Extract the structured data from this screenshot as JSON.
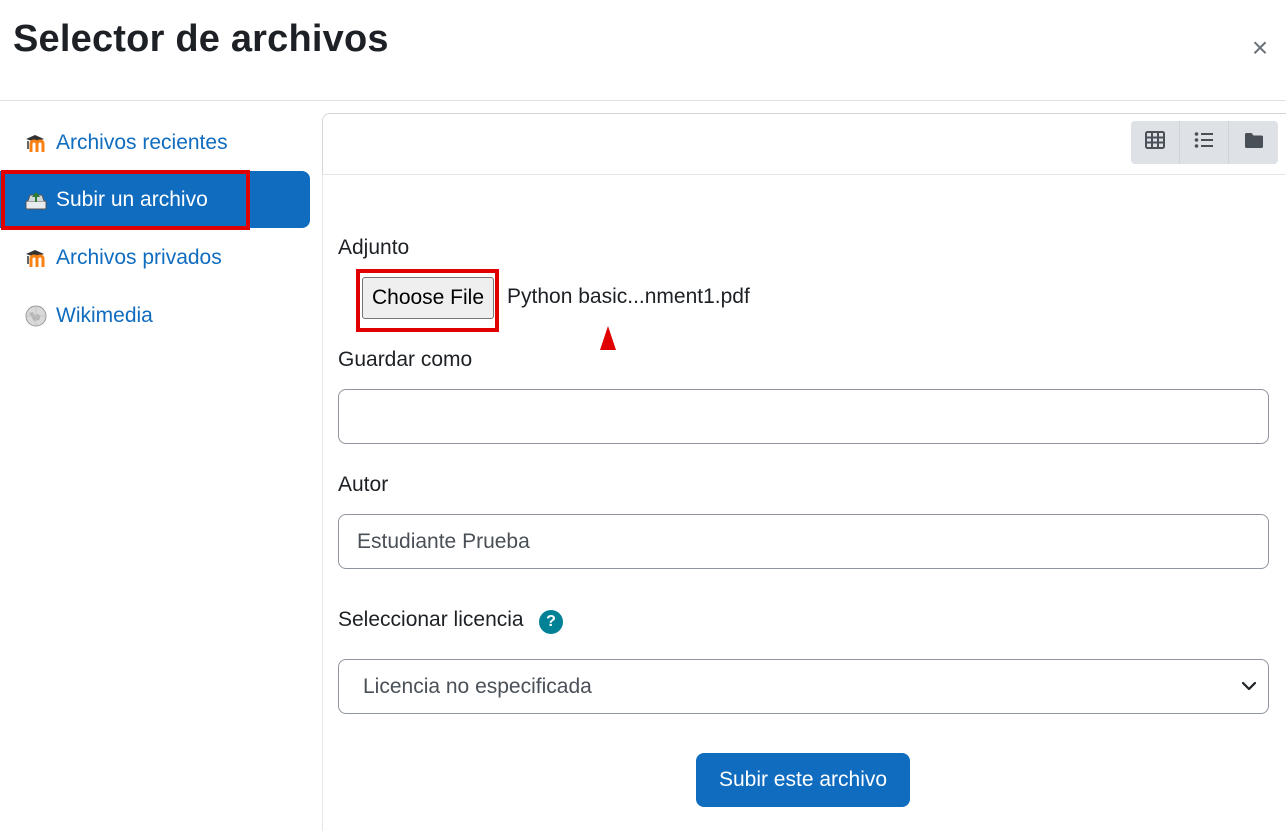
{
  "header": {
    "title": "Selector de archivos",
    "close_label": "×"
  },
  "sidebar": {
    "items": [
      {
        "label": "Archivos recientes",
        "icon": "moodle-icon"
      },
      {
        "label": "Subir un archivo",
        "icon": "upload-icon",
        "active": true
      },
      {
        "label": "Archivos privados",
        "icon": "moodle-icon"
      },
      {
        "label": "Wikimedia",
        "icon": "wikipedia-icon"
      }
    ]
  },
  "toolbar": {
    "views": [
      "grid-view-icon",
      "list-view-icon",
      "folder-view-icon"
    ]
  },
  "form": {
    "attachment_label": "Adjunto",
    "choose_file_label": "Choose File",
    "file_name": "Python basic...nment1.pdf",
    "save_as_label": "Guardar como",
    "save_as_value": "",
    "author_label": "Autor",
    "author_value": "Estudiante Prueba",
    "license_label": "Seleccionar licencia",
    "license_help": "?",
    "license_value": "Licencia no especificada",
    "submit_label": "Subir este archivo"
  },
  "colors": {
    "primary": "#0f6cbf",
    "highlight": "#e00000",
    "help": "#008196"
  }
}
